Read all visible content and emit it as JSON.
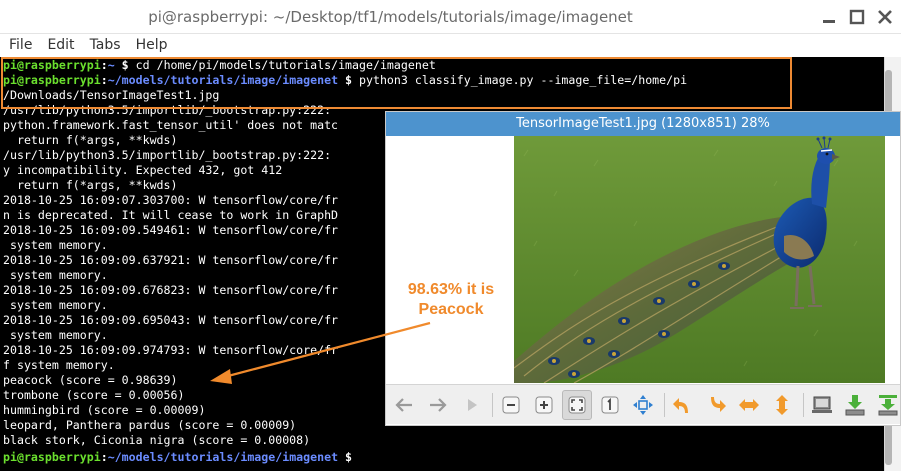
{
  "window": {
    "title": "pi@raspberrypi: ~/Desktop/tf1/models/tutorials/image/imagenet",
    "buttons": [
      "minimize",
      "maximize",
      "close"
    ]
  },
  "menu": [
    "File",
    "Edit",
    "Tabs",
    "Help"
  ],
  "terminal": {
    "prompt1": {
      "user": "pi@raspberrypi",
      "colon": ":",
      "path": "~",
      "symbol": " $ ",
      "command": "cd /home/pi/models/tutorials/image/imagenet"
    },
    "prompt2": {
      "user": "pi@raspberrypi",
      "colon": ":",
      "path": "~/models/tutorials/image/imagenet",
      "symbol": " $ ",
      "command": "python3 classify_image.py --image_file=/home/pi"
    },
    "wrap": "/Downloads/TensorImageTest1.jpg",
    "lines": [
      "/usr/lib/python3.5/importlib/_bootstrap.py:222: ",
      "python.framework.fast_tensor_util' does not matc",
      "  return f(*args, **kwds)",
      "/usr/lib/python3.5/importlib/_bootstrap.py:222: ",
      "y incompatibility. Expected 432, got 412",
      "  return f(*args, **kwds)",
      "2018-10-25 16:09:07.303700: W tensorflow/core/fr",
      "n is deprecated. It will cease to work in GraphD",
      "2018-10-25 16:09:09.549461: W tensorflow/core/fr",
      " system memory.",
      "2018-10-25 16:09:09.637921: W tensorflow/core/fr",
      " system memory.",
      "2018-10-25 16:09:09.676823: W tensorflow/core/fr",
      " system memory.",
      "2018-10-25 16:09:09.695043: W tensorflow/core/fr",
      " system memory.",
      "2018-10-25 16:09:09.974793: W tensorflow/core/fr",
      "f system memory.",
      "peacock (score = 0.98639)",
      "trombone (score = 0.00056)",
      "hummingbird (score = 0.00009)",
      "leopard, Panthera pardus (score = 0.00009)",
      "black stork, Ciconia nigra (score = 0.00008)"
    ],
    "final_prompt": {
      "user": "pi@raspberrypi",
      "colon": ":",
      "path": "~/models/tutorials/image/imagenet",
      "symbol": " $"
    }
  },
  "viewer": {
    "title": "TensorImageTest1.jpg (1280x851) 28%",
    "toolbar": [
      "back-arrow-icon",
      "forward-arrow-icon",
      "play-icon",
      "zoom-out-icon",
      "zoom-in-icon",
      "zoom-fit-icon",
      "zoom-original-icon",
      "fullscreen-icon",
      "rotate-left-icon",
      "rotate-right-icon",
      "flip-horizontal-icon",
      "flip-vertical-icon",
      "open-file-icon",
      "save-icon",
      "save-as-icon"
    ]
  },
  "annotation": {
    "line1": "98.63% it is",
    "line2": "Peacock"
  },
  "colors": {
    "highlight": "#ee8a33",
    "annotation": "#f08a2c",
    "prompt_user": "#6be02e",
    "prompt_path": "#6b8cff",
    "viewer_title": "#4d93ce"
  }
}
